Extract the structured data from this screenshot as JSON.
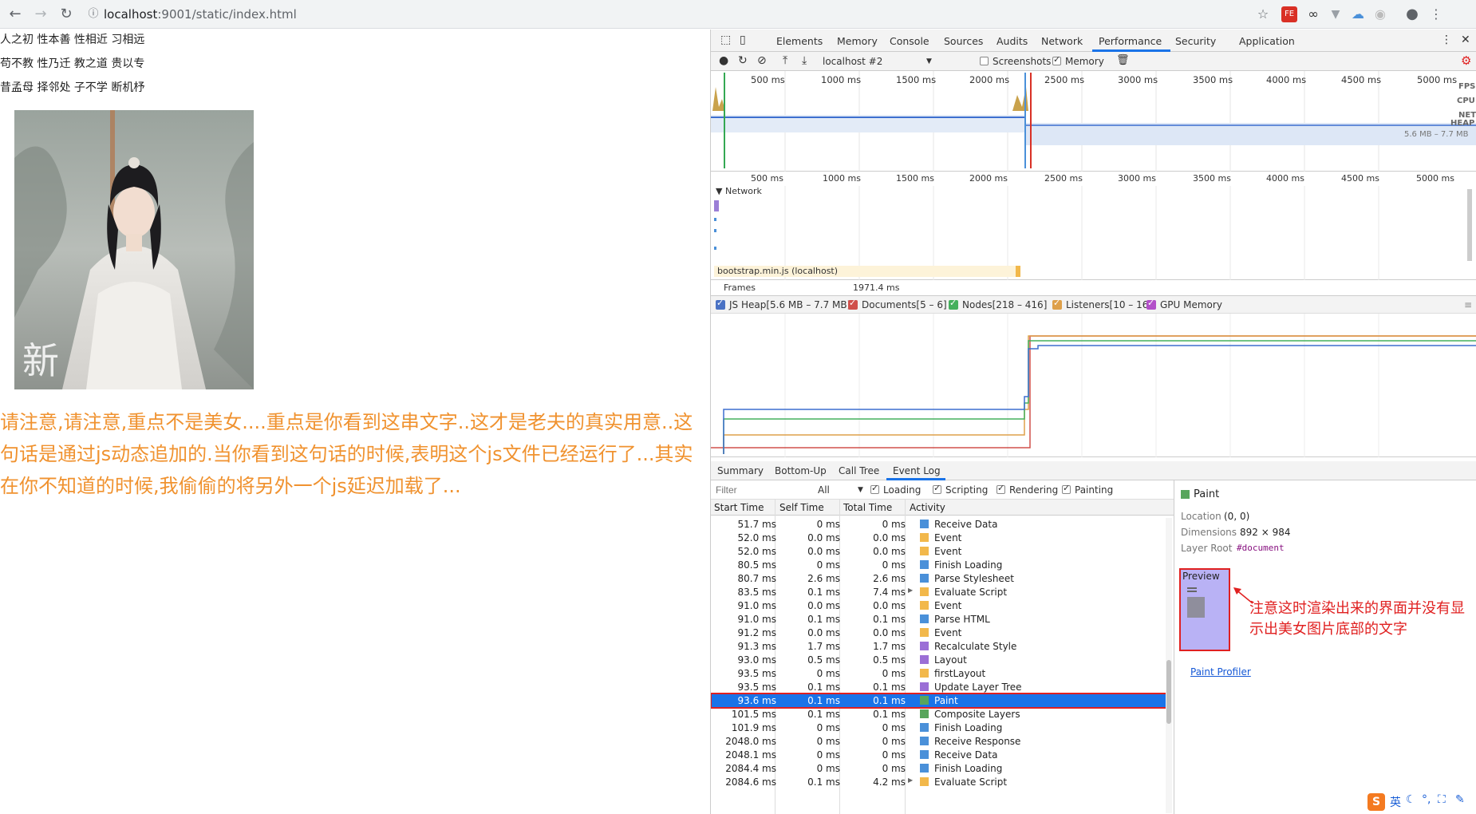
{
  "browser": {
    "url_host": "localhost",
    "url_rest": ":9001/static/index.html",
    "extensions": [
      "bookmark-star-icon",
      "fe-icon",
      "link-icon",
      "vue-icon",
      "cloud-icon",
      "circle-icon",
      "account-icon",
      "menu-icon"
    ]
  },
  "page": {
    "poem_lines": [
      "人之初 性本善 性相近 习相远",
      "苟不教 性乃迁 教之道 贵以专",
      "昔孟母 择邻处 子不学 断机杼"
    ],
    "notice": "请注意,请注意,重点不是美女....重点是你看到这串文字..这才是老夫的真实用意..这句话是通过js动态追加的.当你看到这句话的时候,表明这个js文件已经运行了...其实在你不知道的时候,我偷偷的将另外一个js延迟加载了...",
    "notice_color": "#f0922f"
  },
  "devtools": {
    "tabs": [
      "Elements",
      "Memory",
      "Console",
      "Sources",
      "Audits",
      "Network",
      "Performance",
      "Security",
      "Application"
    ],
    "active_tab": "Performance",
    "profile_select": "localhost #2",
    "screenshots_label": "Screenshots",
    "memory_label": "Memory",
    "timeline_ticks": [
      "500 ms",
      "1000 ms",
      "1500 ms",
      "2000 ms",
      "2500 ms",
      "3000 ms",
      "3500 ms",
      "4000 ms",
      "4500 ms",
      "5000 ms"
    ],
    "overview_lanes": [
      "FPS",
      "CPU",
      "NET",
      "HEAP"
    ],
    "heap_range": "5.6 MB – 7.7 MB",
    "network_label": "Network",
    "network_request": "bootstrap.min.js (localhost)",
    "frames_label": "Frames",
    "frames_value": "1971.4 ms",
    "memory_legend": [
      {
        "label": "JS Heap[5.6 MB – 7.7 MB]",
        "color": "#4a72c4"
      },
      {
        "label": "Documents[5 – 6]",
        "color": "#d0504b"
      },
      {
        "label": "Nodes[218 – 416]",
        "color": "#45b05d"
      },
      {
        "label": "Listeners[10 – 16]",
        "color": "#dea04a"
      },
      {
        "label": "GPU Memory",
        "color": "#b34fc9"
      }
    ],
    "bottom_tabs": [
      "Summary",
      "Bottom-Up",
      "Call Tree",
      "Event Log"
    ],
    "active_bottom_tab": "Event Log",
    "filter_placeholder": "Filter",
    "filter_select": "All",
    "filter_checks": [
      "Loading",
      "Scripting",
      "Rendering",
      "Painting"
    ],
    "columns": [
      "Start Time",
      "Self Time",
      "Total Time",
      "Activity"
    ],
    "rows": [
      {
        "start": "51.7 ms",
        "self": "0 ms",
        "total": "0 ms",
        "activity": "Receive Data",
        "color": "#4a90d9"
      },
      {
        "start": "52.0 ms",
        "self": "0.0 ms",
        "total": "0.0 ms",
        "activity": "Event",
        "color": "#f2b84b"
      },
      {
        "start": "52.0 ms",
        "self": "0.0 ms",
        "total": "0.0 ms",
        "activity": "Event",
        "color": "#f2b84b"
      },
      {
        "start": "80.5 ms",
        "self": "0 ms",
        "total": "0 ms",
        "activity": "Finish Loading",
        "color": "#4a90d9"
      },
      {
        "start": "80.7 ms",
        "self": "2.6 ms",
        "total": "2.6 ms",
        "activity": "Parse Stylesheet",
        "color": "#4a90d9"
      },
      {
        "start": "83.5 ms",
        "self": "0.1 ms",
        "total": "7.4 ms",
        "activity": "Evaluate Script",
        "color": "#f2b84b"
      },
      {
        "start": "91.0 ms",
        "self": "0.0 ms",
        "total": "0.0 ms",
        "activity": "Event",
        "color": "#f2b84b"
      },
      {
        "start": "91.0 ms",
        "self": "0.1 ms",
        "total": "0.1 ms",
        "activity": "Parse HTML",
        "color": "#4a90d9"
      },
      {
        "start": "91.2 ms",
        "self": "0.0 ms",
        "total": "0.0 ms",
        "activity": "Event",
        "color": "#f2b84b"
      },
      {
        "start": "91.3 ms",
        "self": "1.7 ms",
        "total": "1.7 ms",
        "activity": "Recalculate Style",
        "color": "#9b6fd6"
      },
      {
        "start": "93.0 ms",
        "self": "0.5 ms",
        "total": "0.5 ms",
        "activity": "Layout",
        "color": "#9b6fd6"
      },
      {
        "start": "93.5 ms",
        "self": "0 ms",
        "total": "0 ms",
        "activity": "firstLayout",
        "color": "#f2b84b"
      },
      {
        "start": "93.5 ms",
        "self": "0.1 ms",
        "total": "0.1 ms",
        "activity": "Update Layer Tree",
        "color": "#9b6fd6"
      },
      {
        "start": "93.6 ms",
        "self": "0.1 ms",
        "total": "0.1 ms",
        "activity": "Paint",
        "color": "#58a55c"
      },
      {
        "start": "101.5 ms",
        "self": "0.1 ms",
        "total": "0.1 ms",
        "activity": "Composite Layers",
        "color": "#58a55c"
      },
      {
        "start": "101.9 ms",
        "self": "0 ms",
        "total": "0 ms",
        "activity": "Finish Loading",
        "color": "#4a90d9"
      },
      {
        "start": "2048.0 ms",
        "self": "0 ms",
        "total": "0 ms",
        "activity": "Receive Response",
        "color": "#4a90d9"
      },
      {
        "start": "2048.1 ms",
        "self": "0 ms",
        "total": "0 ms",
        "activity": "Receive Data",
        "color": "#4a90d9"
      },
      {
        "start": "2084.4 ms",
        "self": "0 ms",
        "total": "0 ms",
        "activity": "Finish Loading",
        "color": "#4a90d9"
      },
      {
        "start": "2084.6 ms",
        "self": "0.1 ms",
        "total": "4.2 ms",
        "activity": "Evaluate Script",
        "color": "#f2b84b"
      }
    ],
    "selected_row_index": 13,
    "details": {
      "title": "Paint",
      "location_label": "Location",
      "location": "(0, 0)",
      "dimensions_label": "Dimensions",
      "dimensions": "892 × 984",
      "layer_root_label": "Layer Root",
      "layer_root": "#document",
      "preview_label": "Preview",
      "annotation": "注意这时渲染出来的界面并没有显示出美女图片底部的文字",
      "paint_profiler": "Paint Profiler"
    }
  },
  "ime": {
    "label": "英"
  }
}
